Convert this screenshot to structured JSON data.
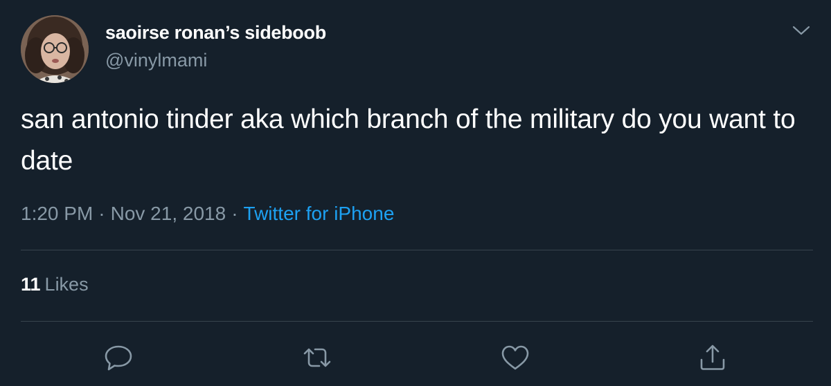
{
  "user": {
    "display_name": "saoirse ronan’s sideboob",
    "handle": "@vinylmami"
  },
  "tweet": {
    "text": "san antonio tinder aka which branch of the military do you want to date",
    "time": "1:20 PM",
    "date": "Nov 21, 2018",
    "separator": "·",
    "source": "Twitter for iPhone"
  },
  "stats": {
    "likes_count": "11",
    "likes_label": "Likes"
  },
  "icons": {
    "more": "chevron-down-icon",
    "reply": "reply-icon",
    "retweet": "retweet-icon",
    "like": "heart-icon",
    "share": "share-icon"
  },
  "colors": {
    "background": "#15202b",
    "secondary_text": "#8899a6",
    "link": "#1da1f2",
    "divider": "#38444d"
  }
}
